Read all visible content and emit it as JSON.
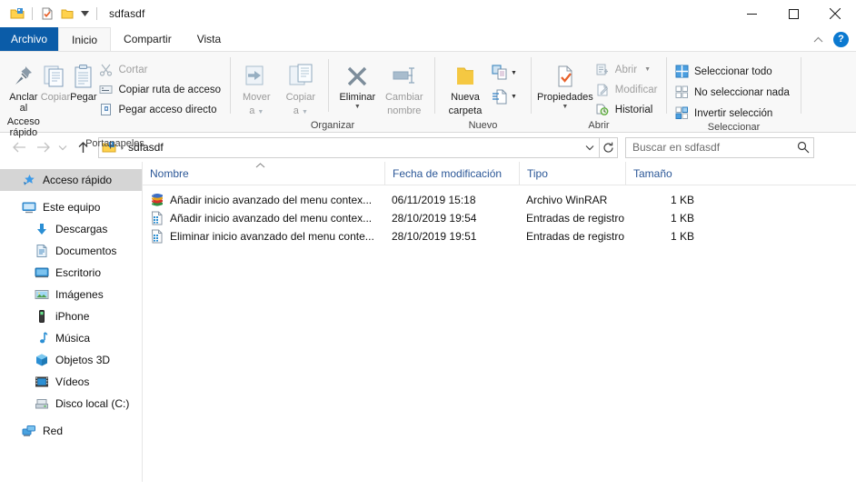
{
  "window": {
    "title": "sdfasdf",
    "minimize_label": "Minimizar",
    "maximize_label": "Maximizar",
    "close_label": "Cerrar"
  },
  "quick_access": {
    "folder_icon": "folder-icon",
    "properties_icon": "properties-icon",
    "new_folder_icon": "new-folder-icon",
    "customize_caret": "▼"
  },
  "tabs": [
    {
      "label": "Archivo",
      "id": "archivo",
      "style": "file"
    },
    {
      "label": "Inicio",
      "id": "inicio",
      "style": "active"
    },
    {
      "label": "Compartir",
      "id": "compartir",
      "style": "normal"
    },
    {
      "label": "Vista",
      "id": "vista",
      "style": "normal"
    }
  ],
  "tabstrip_right": {
    "collapse_ribbon": "⌃",
    "help": "?"
  },
  "ribbon": {
    "groups": [
      {
        "label": "Portapapeles",
        "big_buttons": [
          {
            "label_line1": "Anclar al",
            "label_line2": "Acceso rápido",
            "icon": "pin-icon",
            "dimmed": false
          },
          {
            "label_line1": "Copiar",
            "label_line2": "",
            "icon": "copy-icon",
            "dimmed": true
          },
          {
            "label_line1": "Pegar",
            "label_line2": "",
            "icon": "paste-icon",
            "dimmed": false
          }
        ],
        "small_buttons": [
          {
            "label": "Cortar",
            "icon": "scissors-icon",
            "dimmed": true
          },
          {
            "label": "Copiar ruta de acceso",
            "icon": "copy-path-icon",
            "dimmed": false
          },
          {
            "label": "Pegar acceso directo",
            "icon": "paste-shortcut-icon",
            "dimmed": false
          }
        ]
      },
      {
        "label": "Organizar",
        "big_buttons": [
          {
            "label_line1": "Mover",
            "label_line2": "a",
            "icon": "move-to-icon",
            "dimmed": true,
            "caret": "▼"
          },
          {
            "label_line1": "Copiar",
            "label_line2": "a",
            "icon": "copy-to-icon",
            "dimmed": true,
            "caret": "▼"
          },
          {
            "label_line1": "Eliminar",
            "label_line2": "",
            "icon": "delete-icon",
            "dimmed": false,
            "caret": "▼"
          },
          {
            "label_line1": "Cambiar",
            "label_line2": "nombre",
            "icon": "rename-icon",
            "dimmed": true
          }
        ]
      },
      {
        "label": "Nuevo",
        "big_buttons": [
          {
            "label_line1": "Nueva",
            "label_line2": "carpeta",
            "icon": "new-folder-icon",
            "dimmed": false
          }
        ],
        "stacked_small": [
          {
            "icon": "new-item-icon",
            "caret": "▼"
          },
          {
            "icon": "easy-access-icon",
            "caret": "▼"
          }
        ]
      },
      {
        "label": "Abrir",
        "big_buttons": [
          {
            "label_line1": "Propiedades",
            "label_line2": "",
            "icon": "properties-icon",
            "dimmed": false,
            "caret": "▼"
          }
        ],
        "small_buttons": [
          {
            "label": "Abrir",
            "icon": "open-icon",
            "dimmed": true,
            "caret": "▼"
          },
          {
            "label": "Modificar",
            "icon": "edit-icon",
            "dimmed": true
          },
          {
            "label": "Historial",
            "icon": "history-icon",
            "dimmed": false
          }
        ]
      },
      {
        "label": "Seleccionar",
        "small_buttons": [
          {
            "label": "Seleccionar todo",
            "icon": "select-all-icon",
            "dimmed": false
          },
          {
            "label": "No seleccionar nada",
            "icon": "select-none-icon",
            "dimmed": false
          },
          {
            "label": "Invertir selección",
            "icon": "invert-selection-icon",
            "dimmed": false
          }
        ]
      }
    ]
  },
  "address_bar": {
    "back_label": "Atrás",
    "forward_label": "Adelante",
    "recent_label": "Ubicaciones recientes",
    "up_label": "Subir un nivel",
    "crumb_icon": "folder-icon",
    "crumb_separator": "›",
    "path": "sdfasdf",
    "dropdown_caret": "⌄",
    "refresh_label": "Actualizar"
  },
  "search": {
    "placeholder": "Buscar en sdfasdf",
    "value": "",
    "icon": "search-icon"
  },
  "sidebar": {
    "items": [
      {
        "label": "Acceso rápido",
        "icon": "star-pin-icon",
        "selected": true,
        "indent": false
      },
      {
        "label": "Este equipo",
        "icon": "this-pc-icon",
        "selected": false,
        "indent": false,
        "gap_before": true
      },
      {
        "label": "Descargas",
        "icon": "downloads-icon",
        "selected": false,
        "indent": true
      },
      {
        "label": "Documentos",
        "icon": "documents-icon",
        "selected": false,
        "indent": true
      },
      {
        "label": "Escritorio",
        "icon": "desktop-icon",
        "selected": false,
        "indent": true
      },
      {
        "label": "Imágenes",
        "icon": "pictures-icon",
        "selected": false,
        "indent": true
      },
      {
        "label": "iPhone",
        "icon": "iphone-icon",
        "selected": false,
        "indent": true
      },
      {
        "label": "Música",
        "icon": "music-icon",
        "selected": false,
        "indent": true
      },
      {
        "label": "Objetos 3D",
        "icon": "objects-3d-icon",
        "selected": false,
        "indent": true
      },
      {
        "label": "Vídeos",
        "icon": "videos-icon",
        "selected": false,
        "indent": true
      },
      {
        "label": "Disco local (C:)",
        "icon": "local-disk-icon",
        "selected": false,
        "indent": true
      },
      {
        "label": "Red",
        "icon": "network-icon",
        "selected": false,
        "indent": false,
        "gap_before": true
      }
    ]
  },
  "file_list": {
    "columns": [
      {
        "label": "Nombre",
        "key": "name",
        "sorted": "asc"
      },
      {
        "label": "Fecha de modificación",
        "key": "date"
      },
      {
        "label": "Tipo",
        "key": "type"
      },
      {
        "label": "Tamaño",
        "key": "size"
      }
    ],
    "sort_indicator": "⌃",
    "rows": [
      {
        "name": "Añadir  inicio avanzado del menu contex...",
        "date": "06/11/2019 15:18",
        "type": "Archivo WinRAR",
        "size": "1 KB",
        "icon": "winrar-archive-icon"
      },
      {
        "name": "Añadir  inicio avanzado del menu contex...",
        "date": "28/10/2019 19:54",
        "type": "Entradas de registro",
        "size": "1 KB",
        "icon": "registry-file-icon"
      },
      {
        "name": "Eliminar inicio avanzado del menu conte...",
        "date": "28/10/2019 19:51",
        "type": "Entradas de registro",
        "size": "1 KB",
        "icon": "registry-file-icon"
      }
    ]
  },
  "colors": {
    "file_tab_blue": "#0b5ca8",
    "column_header_text": "#2b5797",
    "selection_gray": "#d5d5d5",
    "accent_blue": "#0b79d0",
    "folder_yellow": "#ffd24d"
  }
}
